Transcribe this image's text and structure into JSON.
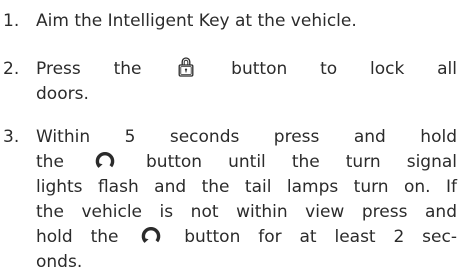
{
  "steps": [
    {
      "number": "1.",
      "lines": [
        "Aim the Intelligent Key at the vehicle."
      ]
    },
    {
      "number": "2.",
      "line1_a": "Press the",
      "line1_b": "button to lock all",
      "line2": "doors.",
      "icon": "lock-button-icon"
    },
    {
      "number": "3.",
      "line1": "Within 5 seconds press and hold",
      "line2_a": "the",
      "line2_b": "button until the turn signal",
      "line3": "lights flash and the tail lamps turn on. If",
      "line4": "the vehicle is not within view press and",
      "line5_a": "hold the",
      "line5_b": "button for at least 2 sec-",
      "line6": "onds.",
      "icon": "remote-start-button-icon"
    }
  ],
  "colors": {
    "text": "#2b2b2b"
  }
}
